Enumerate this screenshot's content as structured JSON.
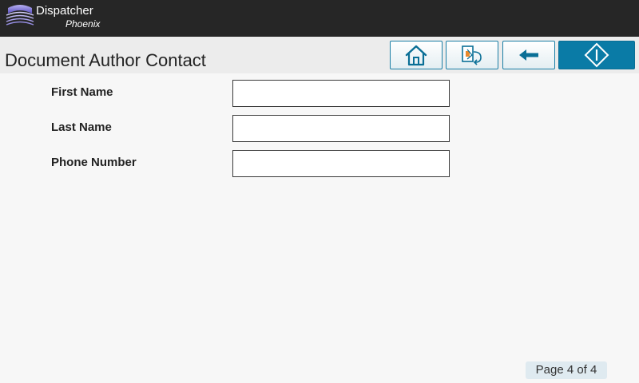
{
  "header": {
    "brand_name": "Dispatcher",
    "brand_sub": "Phoenix",
    "logo_icon": "dispatcher-waves-logo"
  },
  "page": {
    "title": "Document Author Contact"
  },
  "toolbar": {
    "home_icon": "home-icon",
    "document_icon": "document-return-icon",
    "back_icon": "back-arrow-icon",
    "start_icon": "start-diamond-icon",
    "accent_color": "#0a7ba6"
  },
  "form": {
    "fields": [
      {
        "label": "First Name",
        "value": ""
      },
      {
        "label": "Last Name",
        "value": ""
      },
      {
        "label": "Phone Number",
        "value": ""
      }
    ]
  },
  "pagination": {
    "text": "Page 4 of 4"
  }
}
